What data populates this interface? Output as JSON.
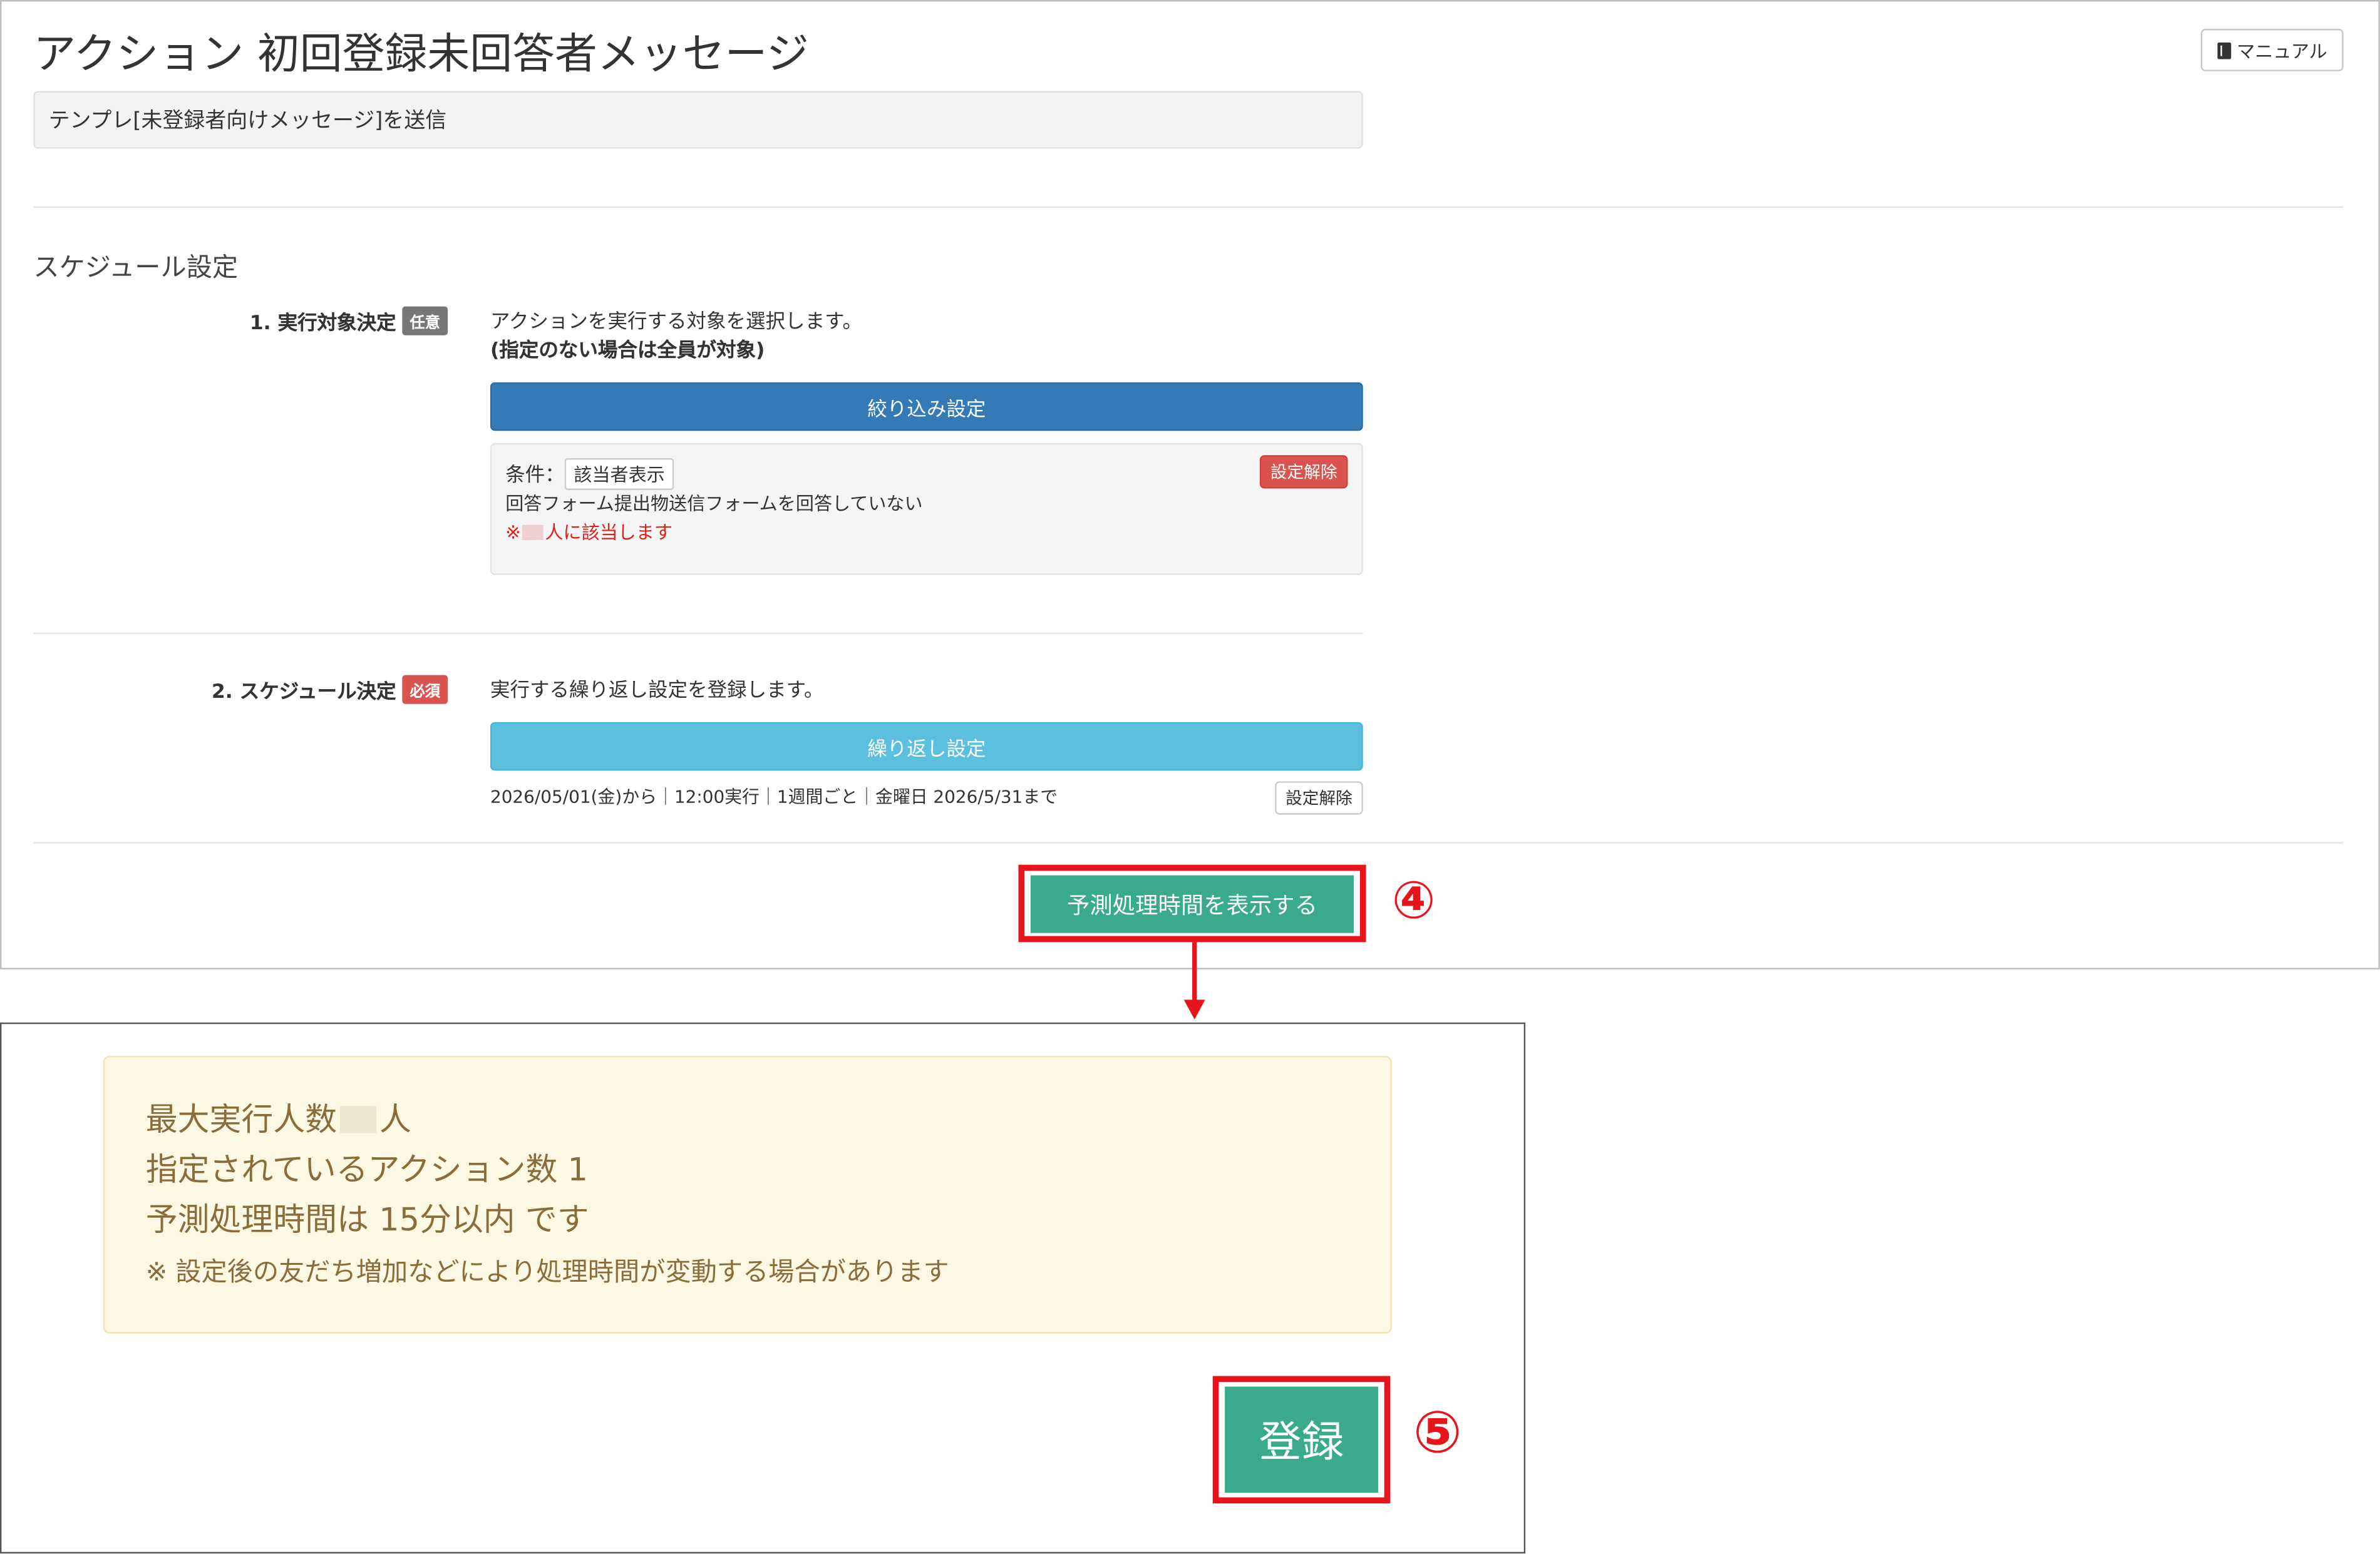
{
  "header": {
    "title": "アクション 初回登録未回答者メッセージ",
    "manual_label": "マニュアル"
  },
  "description": "テンプレ[未登録者向けメッセージ]を送信",
  "schedule": {
    "section_title": "スケジュール設定",
    "step1": {
      "label": "1. 実行対象決定",
      "badge": "任意",
      "text": "アクションを実行する対象を選択します。",
      "note": "(指定のない場合は全員が対象)",
      "filter_button": "絞り込み設定",
      "condition_label": "条件：",
      "condition_tag": "該当者表示",
      "condition_text": "回答フォーム提出物送信フォームを回答していない",
      "match_prefix": "※",
      "match_suffix": "人に該当します",
      "clear_button": "設定解除"
    },
    "step2": {
      "label": "2. スケジュール決定",
      "badge": "必須",
      "text": "実行する繰り返し設定を登録します。",
      "repeat_button": "繰り返し設定",
      "schedule_summary": "2026/05/01(金)から｜12:00実行｜1週間ごと｜金曜日 2026/5/31まで",
      "clear_button": "設定解除"
    }
  },
  "predict_button": "予測処理時間を表示する",
  "annotation_4": "④",
  "annotation_5": "⑤",
  "result": {
    "line1_prefix": "最大実行人数",
    "line1_suffix": "人",
    "line2": "指定されているアクション数 1",
    "line3": "予測処理時間は 15分以内 です",
    "note": "※ 設定後の友だち増加などにより処理時間が変動する場合があります"
  },
  "register_button": "登録",
  "colors": {
    "primary": "#337ab7",
    "info": "#5bc0de",
    "success": "#3aaa8c",
    "danger": "#d9534f",
    "highlight": "#e8141c",
    "warning_bg": "#fcf8e3"
  }
}
